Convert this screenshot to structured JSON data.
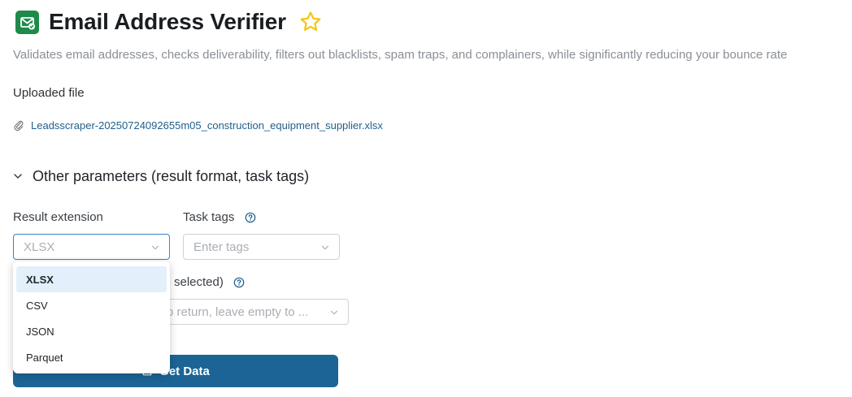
{
  "header": {
    "title": "Email Address Verifier",
    "subtitle": "Validates email addresses, checks deliverability, filters out blacklists, spam traps, and complainers, while significantly reducing your bounce rate",
    "icon": "email-check-icon",
    "favorite_icon": "star-outline-icon",
    "brand_color": "#1e8a4a",
    "star_color": "#f5c518"
  },
  "upload": {
    "label": "Uploaded file",
    "filename": "Leadsscraper-20250724092655m05_construction_equipment_supplier.xlsx",
    "icon": "paperclip-icon"
  },
  "section": {
    "title": "Other parameters (result format, task tags)",
    "icon": "chevron-down-icon"
  },
  "form": {
    "result_extension": {
      "label": "Result extension",
      "value": "XLSX",
      "options": [
        "XLSX",
        "CSV",
        "JSON",
        "Parquet"
      ],
      "selected": "XLSX"
    },
    "task_tags": {
      "label": "Task tags",
      "placeholder": "Enter tags"
    },
    "columns": {
      "label_visible": "selected)",
      "placeholder_visible": "o return, leave empty to ..."
    }
  },
  "actions": {
    "get_data_label": "Get Data",
    "button_color": "#1c6495"
  }
}
